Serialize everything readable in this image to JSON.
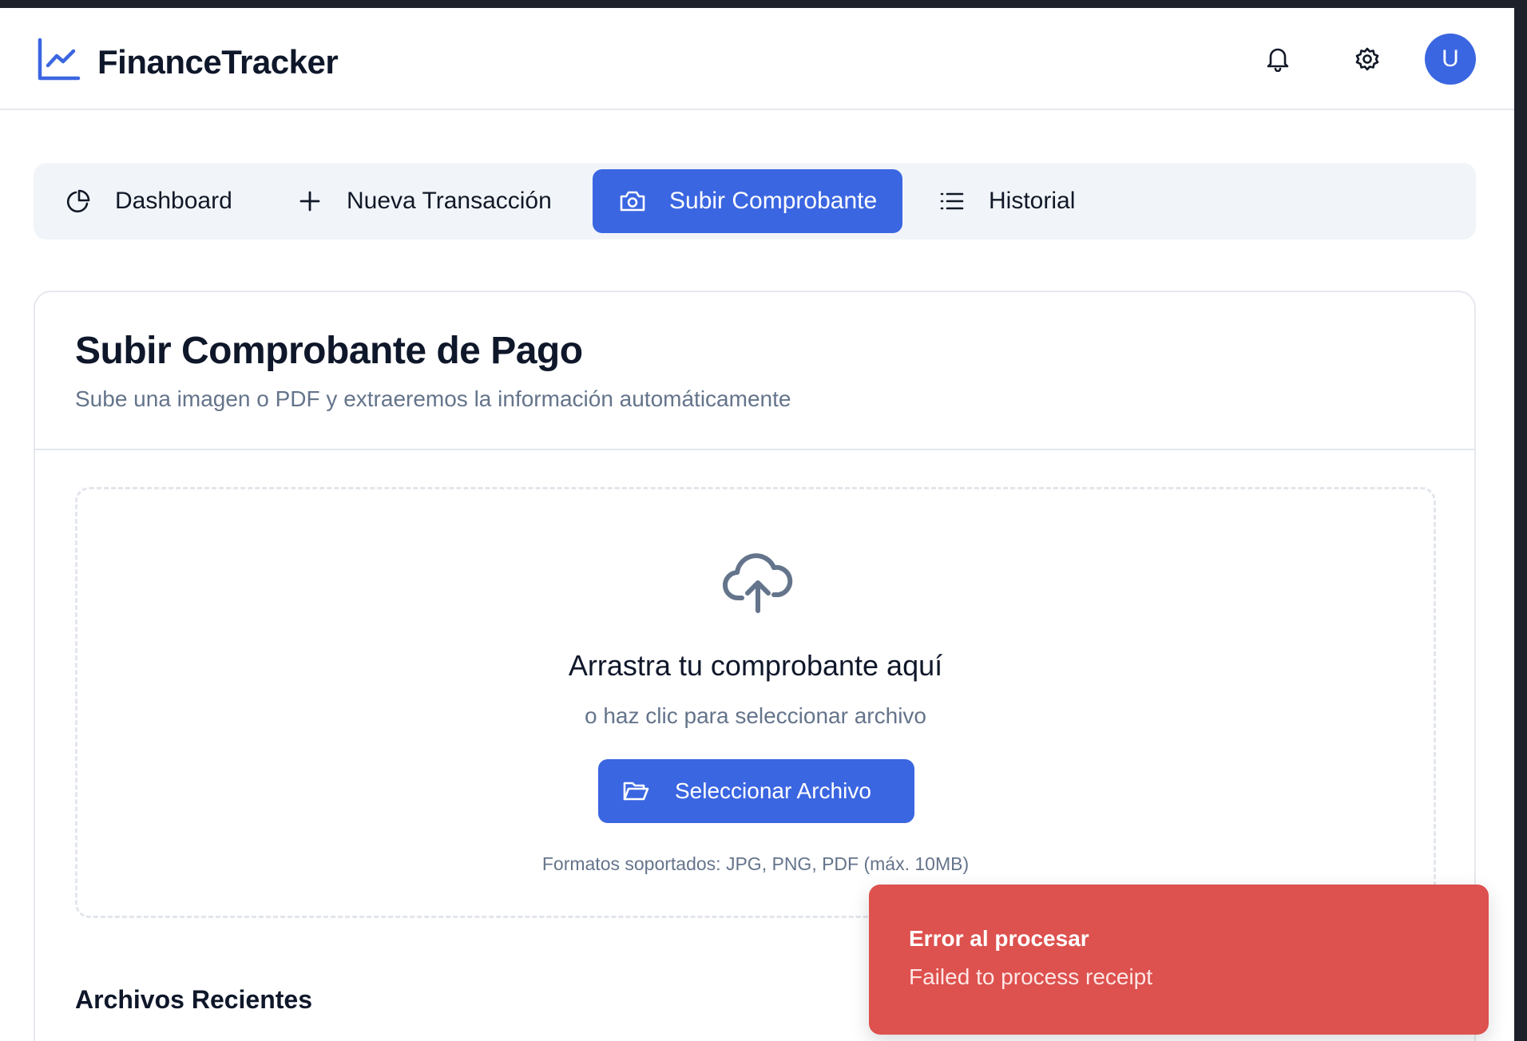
{
  "app": {
    "brand": "FinanceTracker",
    "avatar_initial": "U",
    "accent_color": "#3b66e1",
    "error_color": "#dd514e"
  },
  "header": {
    "icons": [
      "chart-line-icon",
      "bell-icon",
      "gear-icon"
    ]
  },
  "tabs": [
    {
      "label": "Dashboard",
      "icon": "pie-chart-icon",
      "active": false
    },
    {
      "label": "Nueva Transacción",
      "icon": "plus-icon",
      "active": false
    },
    {
      "label": "Subir Comprobante",
      "icon": "camera-icon",
      "active": true
    },
    {
      "label": "Historial",
      "icon": "list-icon",
      "active": false
    }
  ],
  "upload": {
    "title": "Subir Comprobante de Pago",
    "subtitle": "Sube una imagen o PDF y extraeremos la información automáticamente",
    "dropzone_title": "Arrastra tu comprobante aquí",
    "dropzone_sub": "o haz clic para seleccionar archivo",
    "select_button": "Seleccionar Archivo",
    "formats": "Formatos soportados: JPG, PNG, PDF (máx. 10MB)",
    "recent_title": "Archivos Recientes"
  },
  "toast": {
    "title": "Error al procesar",
    "message": "Failed to process receipt"
  }
}
